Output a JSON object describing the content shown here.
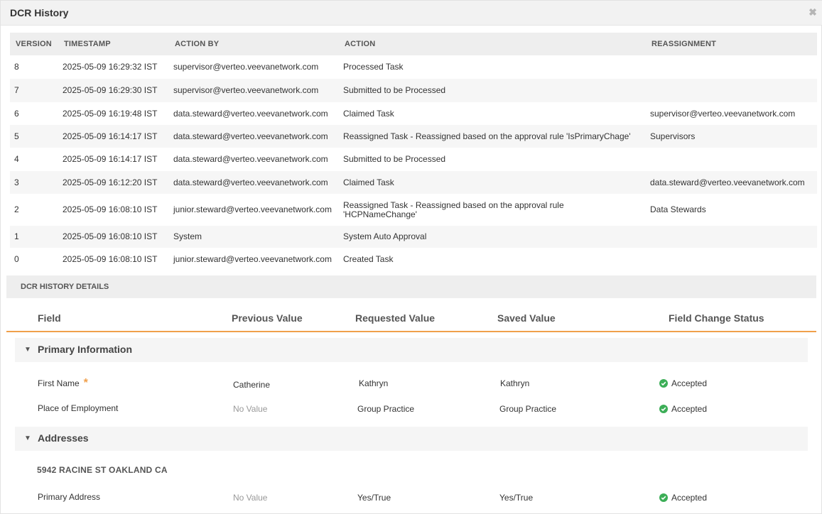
{
  "window": {
    "title": "DCR History"
  },
  "history": {
    "columns": [
      "VERSION",
      "TIMESTAMP",
      "ACTION BY",
      "ACTION",
      "REASSIGNMENT"
    ],
    "rows": [
      {
        "version": "8",
        "timestamp": "2025-05-09 16:29:32 IST",
        "action_by": "supervisor@verteo.veevanetwork.com",
        "action": "Processed Task",
        "reassignment": ""
      },
      {
        "version": "7",
        "timestamp": "2025-05-09 16:29:30 IST",
        "action_by": "supervisor@verteo.veevanetwork.com",
        "action": "Submitted to be Processed",
        "reassignment": ""
      },
      {
        "version": "6",
        "timestamp": "2025-05-09 16:19:48 IST",
        "action_by": "data.steward@verteo.veevanetwork.com",
        "action": "Claimed Task",
        "reassignment": "supervisor@verteo.veevanetwork.com"
      },
      {
        "version": "5",
        "timestamp": "2025-05-09 16:14:17 IST",
        "action_by": "data.steward@verteo.veevanetwork.com",
        "action": "Reassigned Task - Reassigned based on the approval rule 'IsPrimaryChage'",
        "reassignment": "Supervisors"
      },
      {
        "version": "4",
        "timestamp": "2025-05-09 16:14:17 IST",
        "action_by": "data.steward@verteo.veevanetwork.com",
        "action": "Submitted to be Processed",
        "reassignment": ""
      },
      {
        "version": "3",
        "timestamp": "2025-05-09 16:12:20 IST",
        "action_by": "data.steward@verteo.veevanetwork.com",
        "action": "Claimed Task",
        "reassignment": "data.steward@verteo.veevanetwork.com"
      },
      {
        "version": "2",
        "timestamp": "2025-05-09 16:08:10 IST",
        "action_by": "junior.steward@verteo.veevanetwork.com",
        "action": "Reassigned Task - Reassigned based on the approval rule 'HCPNameChange'",
        "reassignment": "Data Stewards"
      },
      {
        "version": "1",
        "timestamp": "2025-05-09 16:08:10 IST",
        "action_by": "System",
        "action": "System Auto Approval",
        "reassignment": ""
      },
      {
        "version": "0",
        "timestamp": "2025-05-09 16:08:10 IST",
        "action_by": "junior.steward@verteo.veevanetwork.com",
        "action": "Created Task",
        "reassignment": ""
      }
    ]
  },
  "details": {
    "label": "DCR HISTORY DETAILS",
    "columns": {
      "field": "Field",
      "previous": "Previous Value",
      "requested": "Requested Value",
      "saved": "Saved Value",
      "status": "Field Change Status"
    },
    "sections": [
      {
        "title": "Primary Information",
        "rows": [
          {
            "field": "First Name",
            "required_mark": "*",
            "previous": "Catherine",
            "requested": "Kathryn",
            "saved": "Kathryn",
            "status": "Accepted"
          },
          {
            "field": "Place of Employment",
            "previous": "No Value",
            "requested": "Group Practice",
            "saved": "Group Practice",
            "status": "Accepted"
          }
        ]
      },
      {
        "title": "Addresses",
        "subtitle": "5942 RACINE ST OAKLAND CA",
        "rows": [
          {
            "field": "Primary Address",
            "previous": "No Value",
            "requested": "Yes/True",
            "saved": "Yes/True",
            "status": "Accepted"
          }
        ]
      }
    ]
  },
  "icons": {
    "close": "close-icon",
    "collapse": "caret-down-icon",
    "accepted": "check-circle-icon"
  },
  "colors": {
    "accent": "#f0a04b",
    "accepted": "#3cae57",
    "header_bg": "#eeeeee"
  }
}
